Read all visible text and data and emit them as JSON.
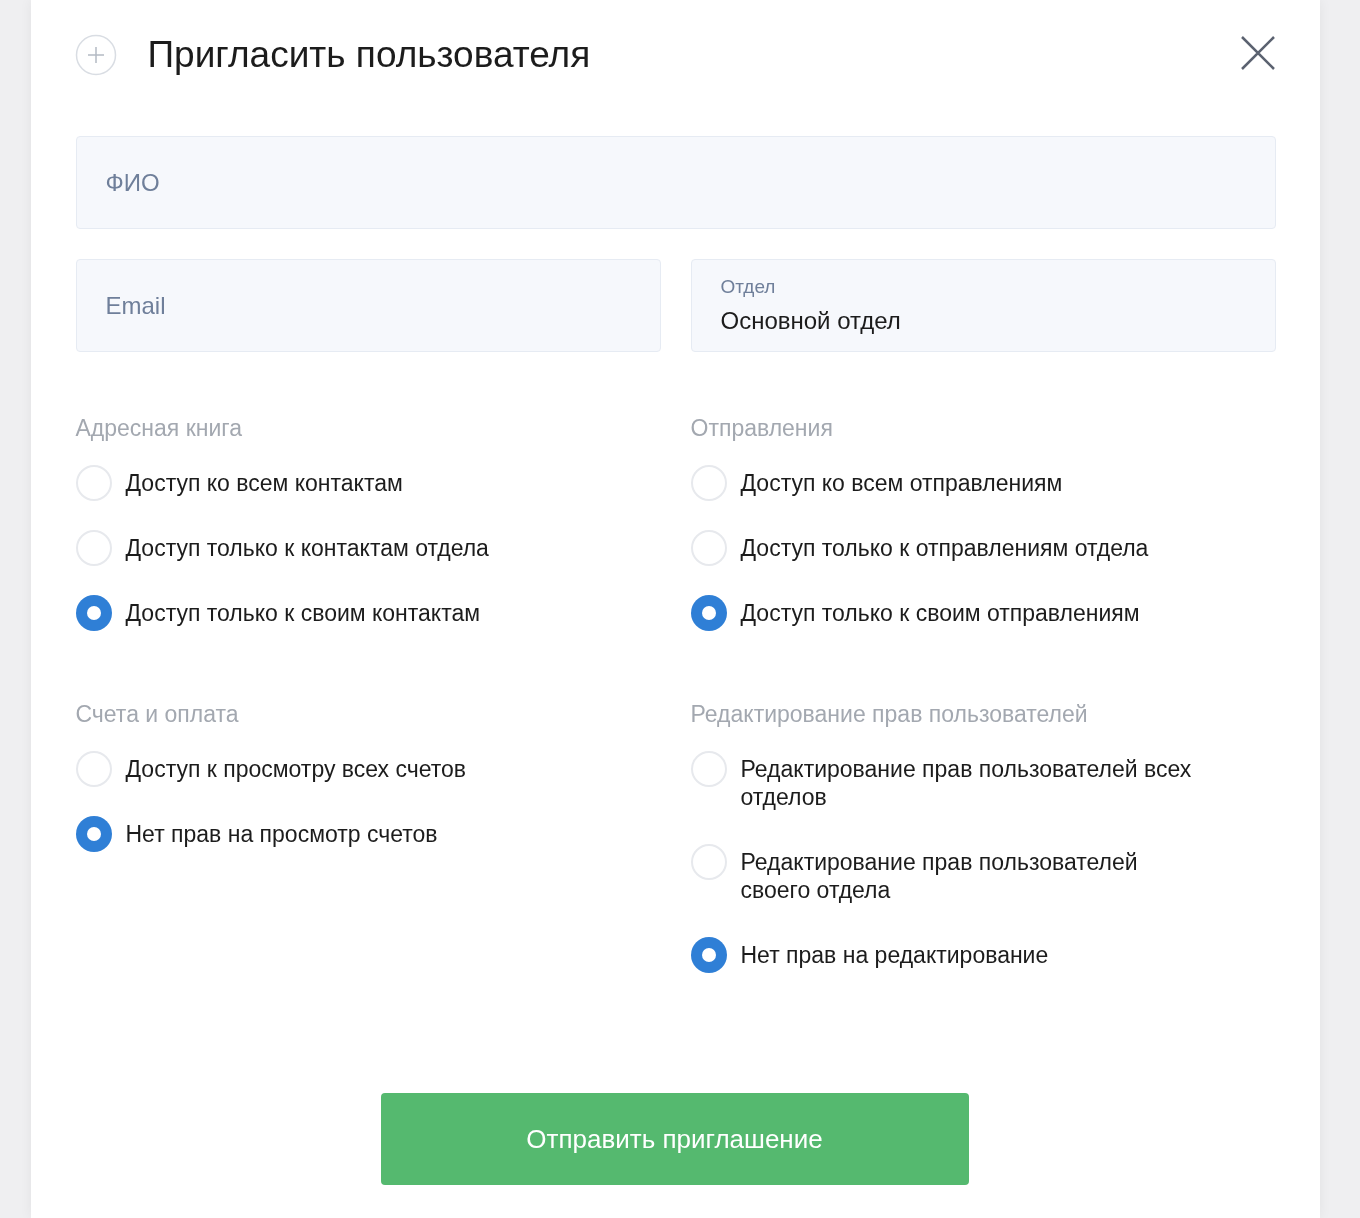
{
  "dialog": {
    "title": "Пригласить пользователя"
  },
  "fields": [
    {
      "kind": "placeholder",
      "placeholder": "ФИО"
    },
    {
      "kind": "placeholder",
      "placeholder": "Email"
    },
    {
      "kind": "select",
      "label": "Отдел",
      "value": "Основной отдел"
    }
  ],
  "sections": [
    {
      "heading": "Адресная книга",
      "options": [
        {
          "label": "Доступ ко всем контактам",
          "selected": false
        },
        {
          "label": "Доступ только к контактам отдела",
          "selected": false
        },
        {
          "label": "Доступ только к своим контактам",
          "selected": true
        }
      ]
    },
    {
      "heading": "Отправления",
      "options": [
        {
          "label": "Доступ ко всем отправлениям",
          "selected": false
        },
        {
          "label": "Доступ только к отправлениям отдела",
          "selected": false
        },
        {
          "label": "Доступ только к своим отправлениям",
          "selected": true
        }
      ]
    },
    {
      "heading": "Счета и оплата",
      "options": [
        {
          "label": "Доступ к просмотру всех счетов",
          "selected": false
        },
        {
          "label": "Нет прав на просмотр счетов",
          "selected": true
        }
      ]
    },
    {
      "heading": "Редактирование прав пользователей",
      "options": [
        {
          "label": "Редактирование прав пользователей всех отделов",
          "selected": false
        },
        {
          "label": "Редактирование прав пользователей своего отдела",
          "selected": false
        },
        {
          "label": "Нет прав на редактирование",
          "selected": true
        }
      ]
    }
  ],
  "submit_button": "Отправить приглашение"
}
